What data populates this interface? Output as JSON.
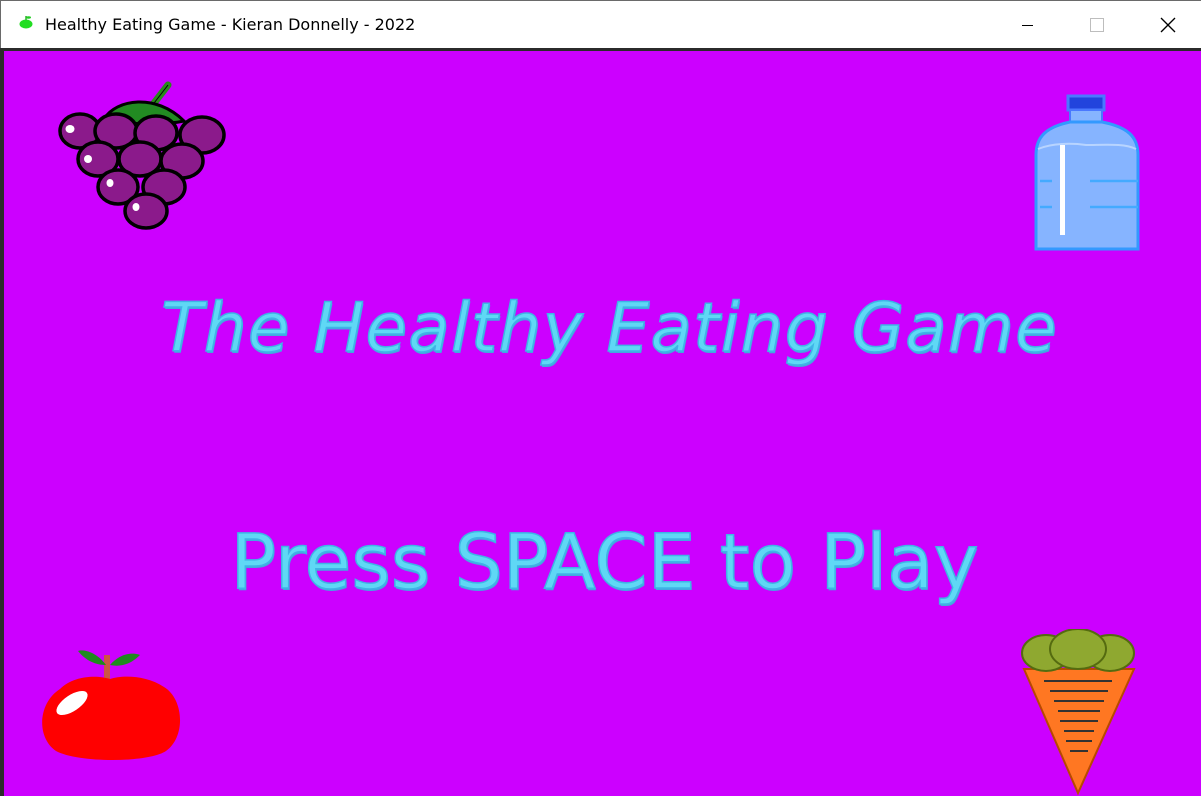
{
  "window": {
    "title": "Healthy Eating Game - Kieran Donnelly - 2022",
    "icon": "green-apple-icon",
    "controls": {
      "minimize": "minimize-icon",
      "maximize": "maximize-icon",
      "close": "close-icon"
    }
  },
  "game": {
    "background_color": "#cc00ff",
    "text_color": "#5fd8f5",
    "title": "The Healthy Eating Game",
    "prompt": "Press SPACE to Play",
    "sprites": [
      "grapes",
      "water-bottle",
      "apple",
      "carrot"
    ]
  }
}
